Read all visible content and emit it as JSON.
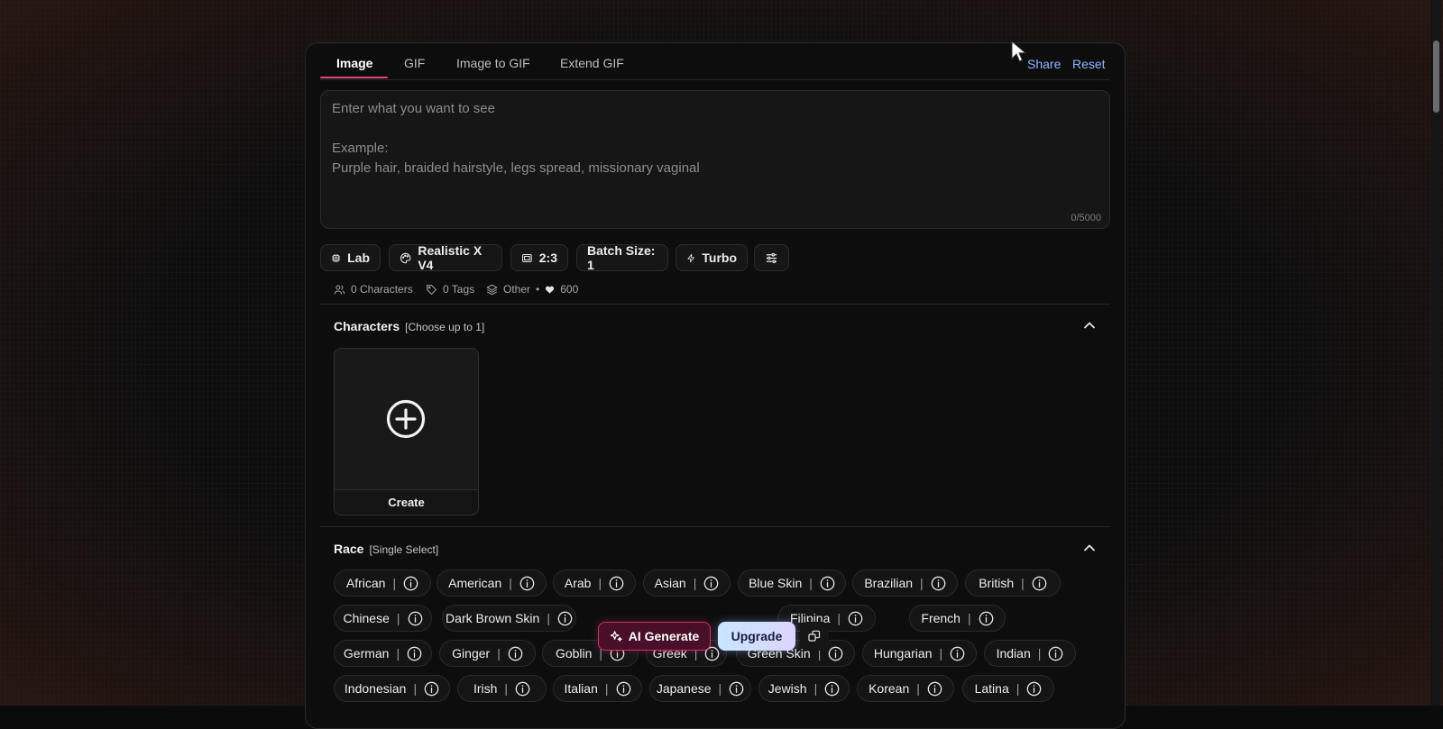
{
  "tabs": [
    {
      "label": "Image"
    },
    {
      "label": "GIF"
    },
    {
      "label": "Image to GIF"
    },
    {
      "label": "Extend GIF"
    }
  ],
  "top_links": {
    "share": "Share",
    "reset": "Reset"
  },
  "prompt": {
    "line1": "Enter what you want to see",
    "line2": "Example:",
    "line3": "Purple hair, braided hairstyle, legs spread, missionary vaginal",
    "counter": "0/5000"
  },
  "options": {
    "lab": "Lab",
    "model": "Realistic X V4",
    "ratio": "2:3",
    "batch": "Batch Size: 1",
    "speed": "Turbo"
  },
  "meta": {
    "characters": "0 Characters",
    "tags": "0 Tags",
    "category": "Other",
    "bullet": "•",
    "cost": "600"
  },
  "characters_section": {
    "title": "Characters",
    "subtitle": "[Choose up to 1]",
    "create_label": "Create"
  },
  "race_section": {
    "title": "Race",
    "subtitle": "[Single Select]"
  },
  "race_options": [
    [
      "African",
      "American",
      "Arab",
      "Asian",
      "Blue Skin",
      "Brazilian",
      "British"
    ],
    [
      "Chinese",
      "Dark Brown Skin",
      "Filipina",
      "French"
    ],
    [
      "German",
      "Ginger",
      "Goblin",
      "Greek",
      "Green Skin",
      "Hungarian",
      "Indian"
    ],
    [
      "Indonesian",
      "Irish",
      "Italian",
      "Japanese",
      "Jewish",
      "Korean",
      "Latina"
    ]
  ],
  "chip_separator": "|",
  "floating": {
    "ai_generate": "AI Generate",
    "upgrade": "Upgrade"
  },
  "colors": {
    "accent": "#e0457b",
    "link": "#8fb5ff",
    "panel": "#0d0d0e"
  }
}
